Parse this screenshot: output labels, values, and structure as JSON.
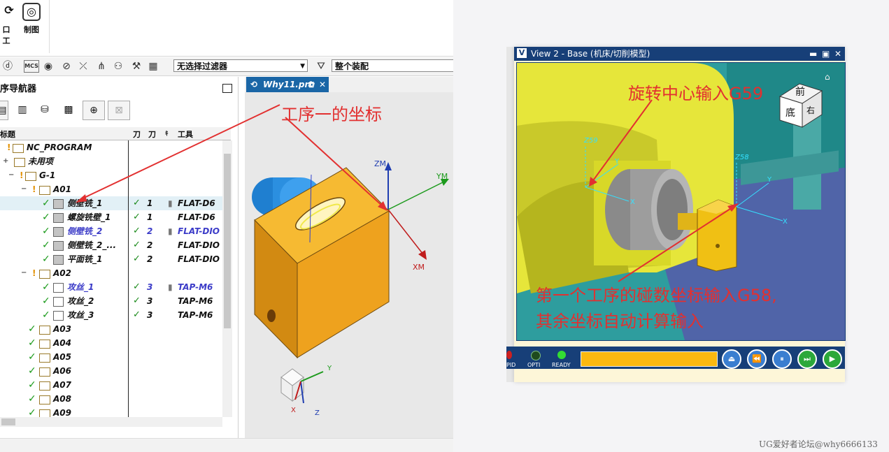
{
  "ribbon": {
    "btn1_label": "加工",
    "btn1_partial": "口工",
    "btn2_label": "制图"
  },
  "toolbar2": {
    "mcs_label": "MCS",
    "filter_value": "无选择过滤器",
    "assembly_value": "整个装配"
  },
  "navigator": {
    "title": "序导航器",
    "columns": {
      "name": "标题",
      "tool1": "刀",
      "tool2": "刀",
      "tool3": "刀",
      "toolname": "工具"
    },
    "rows": [
      {
        "name": "NC_PROGRAM",
        "c1": "",
        "c1b": "",
        "c3": ""
      },
      {
        "name": "未用项",
        "c1": "",
        "c1b": "",
        "c3": ""
      },
      {
        "name": "G-1",
        "c1": "",
        "c1b": "",
        "c3": ""
      },
      {
        "name": "A01",
        "c1": "",
        "c1b": "",
        "c3": ""
      },
      {
        "name": "侧壁铣_1",
        "c1": "✓",
        "c1b": "1",
        "c3": "FLAT-D6"
      },
      {
        "name": "螺旋铣壁_1",
        "c1": "✓",
        "c1b": "1",
        "c3": "FLAT-D6"
      },
      {
        "name": "侧壁铣_2",
        "c1": "✓",
        "c1b": "2",
        "c3": "FLAT-DIO"
      },
      {
        "name": "侧壁铣_2_...",
        "c1": "✓",
        "c1b": "2",
        "c3": "FLAT-DIO"
      },
      {
        "name": "平面铣_1",
        "c1": "✓",
        "c1b": "2",
        "c3": "FLAT-DIO"
      },
      {
        "name": "A02",
        "c1": "",
        "c1b": "",
        "c3": ""
      },
      {
        "name": "攻丝_1",
        "c1": "✓",
        "c1b": "3",
        "c3": "TAP-M6"
      },
      {
        "name": "攻丝_2",
        "c1": "✓",
        "c1b": "3",
        "c3": "TAP-M6"
      },
      {
        "name": "攻丝_3",
        "c1": "✓",
        "c1b": "3",
        "c3": "TAP-M6"
      },
      {
        "name": "A03",
        "c1": "",
        "c1b": "",
        "c3": ""
      },
      {
        "name": "A04",
        "c1": "",
        "c1b": "",
        "c3": ""
      },
      {
        "name": "A05",
        "c1": "",
        "c1b": "",
        "c3": ""
      },
      {
        "name": "A06",
        "c1": "",
        "c1b": "",
        "c3": ""
      },
      {
        "name": "A07",
        "c1": "",
        "c1b": "",
        "c3": ""
      },
      {
        "name": "A08",
        "c1": "",
        "c1b": "",
        "c3": ""
      },
      {
        "name": "A09",
        "c1": "",
        "c1b": "",
        "c3": ""
      }
    ]
  },
  "graphics": {
    "tab_label": "Why11.prt",
    "axes": {
      "zm": "ZM",
      "ym": "YM",
      "xm": "XM",
      "y": "Y",
      "x": "X",
      "z": "Z"
    },
    "annotation": "工序一的坐标"
  },
  "vericut": {
    "title": "View 2 - Base (机床/切削模型)",
    "cube": {
      "front": "前",
      "bottom": "底",
      "right": "右"
    },
    "axes": {
      "z59": "Z59",
      "z58": "Z58",
      "x": "X",
      "y": "Y"
    },
    "annotation_top": "旋转中心输入G59",
    "annotation_bottom_1": "第一个工序的碰数坐标输入G58,",
    "annotation_bottom_2": "其余坐标自动计算输入",
    "leds": {
      "rapid": "PID",
      "opti": "OPTI",
      "ready": "READY"
    },
    "progress_color": "#fbb810"
  },
  "watermark": "UG爱好者论坛@why6666133",
  "colors": {
    "titlebar": "#173f78",
    "accent": "#1a66a6",
    "annotation": "#e23030",
    "check": "#1a9a1a",
    "part": "#f0a81c"
  }
}
